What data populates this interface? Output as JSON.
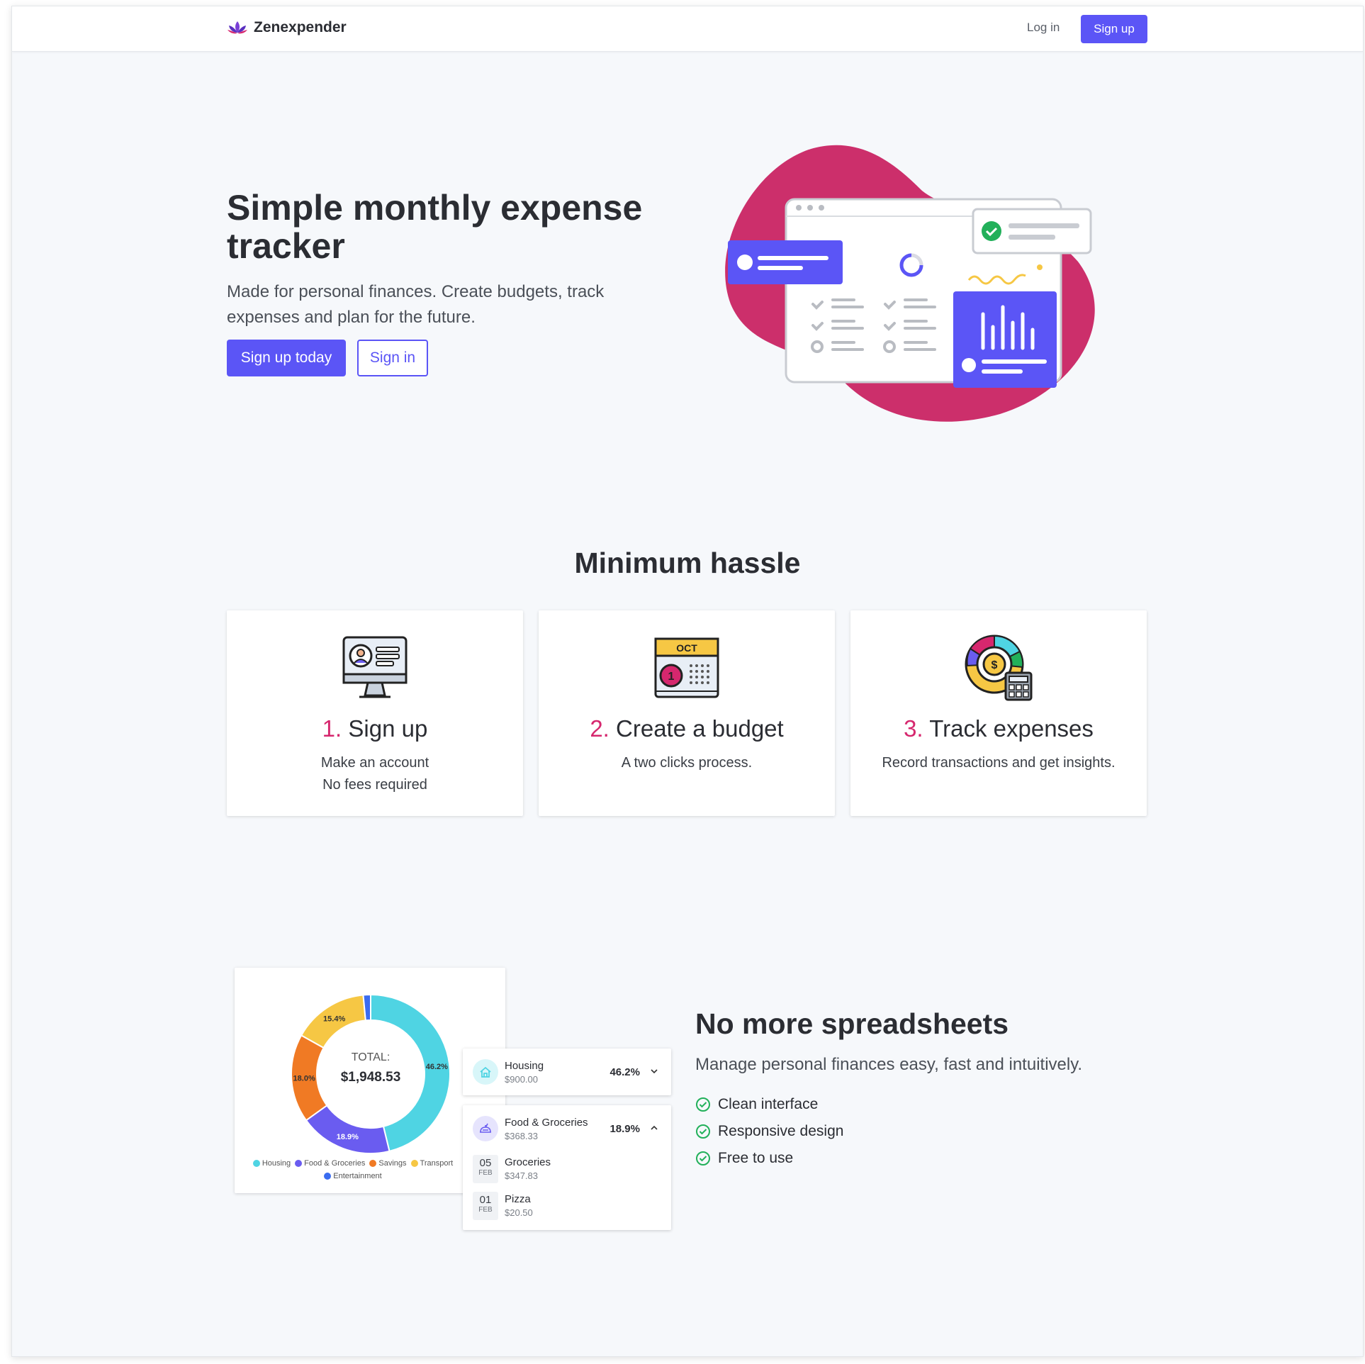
{
  "nav": {
    "brand": "Zenexpender",
    "login": "Log in",
    "signup": "Sign up"
  },
  "hero": {
    "title": "Simple monthly expense tracker",
    "subtitle": "Made for personal finances. Create budgets, track expenses and plan for the future.",
    "cta_primary": "Sign up today",
    "cta_secondary": "Sign in"
  },
  "steps": {
    "title": "Minimum hassle",
    "items": [
      {
        "num": "1.",
        "title": "Sign up",
        "lines": [
          "Make an account",
          "No fees required"
        ],
        "icon": "computer-profile-icon"
      },
      {
        "num": "2.",
        "title": "Create a budget",
        "lines": [
          "A two clicks process."
        ],
        "icon": "calendar-icon",
        "icon_text": "OCT",
        "icon_day": "1"
      },
      {
        "num": "3.",
        "title": "Track expenses",
        "lines": [
          "Record transactions and get insights."
        ],
        "icon": "chart-calculator-icon"
      }
    ]
  },
  "features": {
    "title": "No more spreadsheets",
    "subtitle": "Manage personal finances easy, fast and intuitively.",
    "items": [
      "Clean interface",
      "Responsive design",
      "Free to use"
    ],
    "accent": "#22b05a"
  },
  "chart_data": {
    "type": "pie",
    "donut": true,
    "center_label": "TOTAL:",
    "center_value": "$1,948.53",
    "categories": [
      "Housing",
      "Food & Groceries",
      "Savings",
      "Transport",
      "Entertainment"
    ],
    "values": [
      46.2,
      18.9,
      18.0,
      15.4,
      1.5
    ],
    "labels": [
      "46.2%",
      "18.9%",
      "18.0%",
      "15.4%",
      ""
    ],
    "colors": [
      "#4fd4e3",
      "#6a5cf0",
      "#f07a24",
      "#f6c744",
      "#3a6cf0"
    ],
    "legend": [
      "Housing",
      "Food & Groceries",
      "Savings",
      "Transport",
      "Entertainment"
    ],
    "legend_position": "bottom"
  },
  "categories": [
    {
      "name": "Housing",
      "amount": "$900.00",
      "pct": "46.2%",
      "icon": "house-icon",
      "expanded": false
    },
    {
      "name": "Food & Groceries",
      "amount": "$368.33",
      "pct": "18.9%",
      "icon": "food-icon",
      "expanded": true,
      "transactions": [
        {
          "day": "05",
          "month": "FEB",
          "name": "Groceries",
          "amount": "$347.83"
        },
        {
          "day": "01",
          "month": "FEB",
          "name": "Pizza",
          "amount": "$20.50"
        }
      ]
    }
  ],
  "colors": {
    "brand": "#5b55f6",
    "accent_pink": "#d6276e",
    "blob": "#cc2f6b"
  }
}
